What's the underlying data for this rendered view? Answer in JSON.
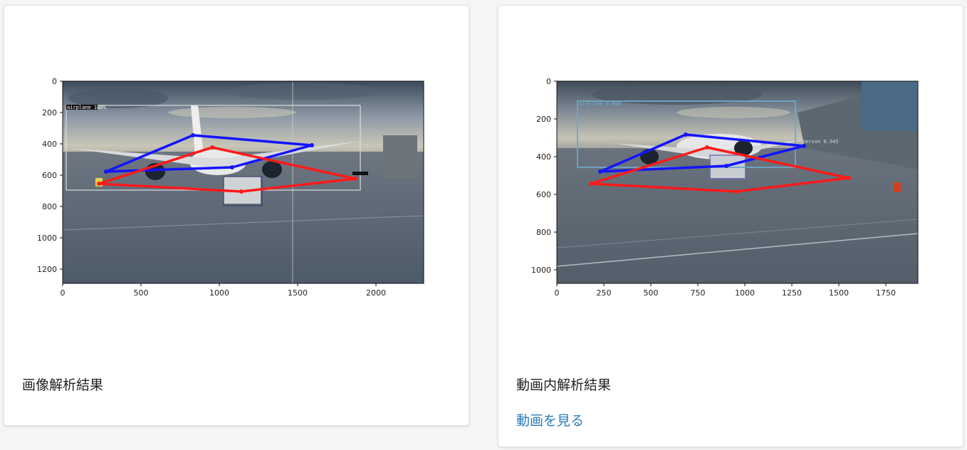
{
  "cards": [
    {
      "title": "画像解析結果",
      "image": {
        "x_ticks": [
          "0",
          "500",
          "1000",
          "1500",
          "2000"
        ],
        "y_ticks": [
          "0",
          "200",
          "400",
          "600",
          "800",
          "1000",
          "1200"
        ],
        "detection_labels": [
          "airplane 100%"
        ]
      }
    },
    {
      "title": "動画内解析結果",
      "link_label": "動画を見る",
      "image": {
        "x_ticks": [
          "0",
          "250",
          "500",
          "750",
          "1000",
          "1250",
          "1500",
          "1750"
        ],
        "y_ticks": [
          "0",
          "200",
          "400",
          "600",
          "800",
          "1000"
        ],
        "detection_labels": [
          "airplane 0.988",
          "person 0.945"
        ]
      }
    }
  ],
  "colors": {
    "link": "#2a7ab8",
    "polygon_blue": "#1414ff",
    "polygon_red": "#ff1a1a"
  }
}
